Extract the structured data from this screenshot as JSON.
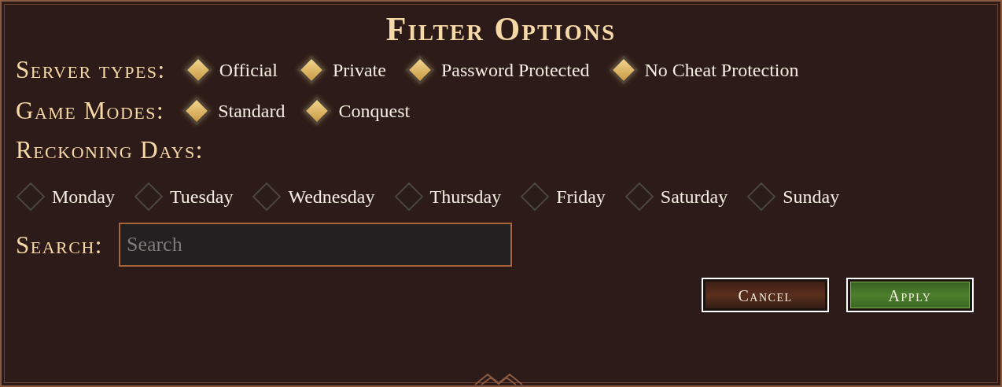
{
  "title": "Filter Options",
  "server_types": {
    "label": "Server types:",
    "options": [
      {
        "label": "Official",
        "checked": true
      },
      {
        "label": "Private",
        "checked": true
      },
      {
        "label": "Password Protected",
        "checked": true
      },
      {
        "label": "No Cheat Protection",
        "checked": true
      }
    ]
  },
  "game_modes": {
    "label": "Game Modes:",
    "options": [
      {
        "label": "Standard",
        "checked": true
      },
      {
        "label": "Conquest",
        "checked": true
      }
    ]
  },
  "reckoning_days": {
    "label": "Reckoning Days:",
    "options": [
      {
        "label": "Monday",
        "checked": false
      },
      {
        "label": "Tuesday",
        "checked": false
      },
      {
        "label": "Wednesday",
        "checked": false
      },
      {
        "label": "Thursday",
        "checked": false
      },
      {
        "label": "Friday",
        "checked": false
      },
      {
        "label": "Saturday",
        "checked": false
      },
      {
        "label": "Sunday",
        "checked": false
      }
    ]
  },
  "search": {
    "label": "Search:",
    "placeholder": "Search"
  },
  "buttons": [
    {
      "label": "Cancel",
      "kind": "cancel"
    },
    {
      "label": "Apply",
      "kind": "apply"
    }
  ]
}
